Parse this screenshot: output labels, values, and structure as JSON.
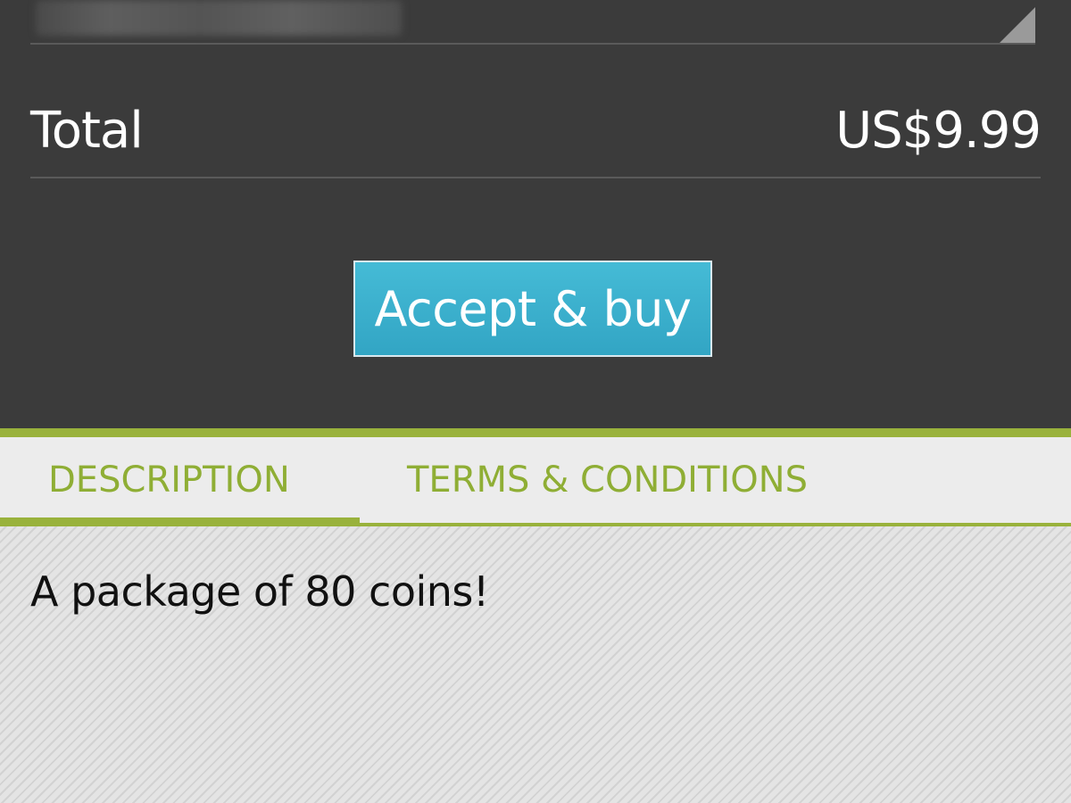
{
  "purchase": {
    "total_label": "Total",
    "total_price": "US$9.99",
    "accept_button_label": "Accept & buy"
  },
  "tabs": [
    {
      "label": "DESCRIPTION",
      "selected": true
    },
    {
      "label": "TERMS & CONDITIONS",
      "selected": false
    }
  ],
  "description": {
    "text": "A package of 80 coins!"
  },
  "colors": {
    "panel_background": "#3b3b3b",
    "accent_green": "#99b23c",
    "button_blue": "#3bb0cd",
    "content_background": "#e8e8e8"
  }
}
